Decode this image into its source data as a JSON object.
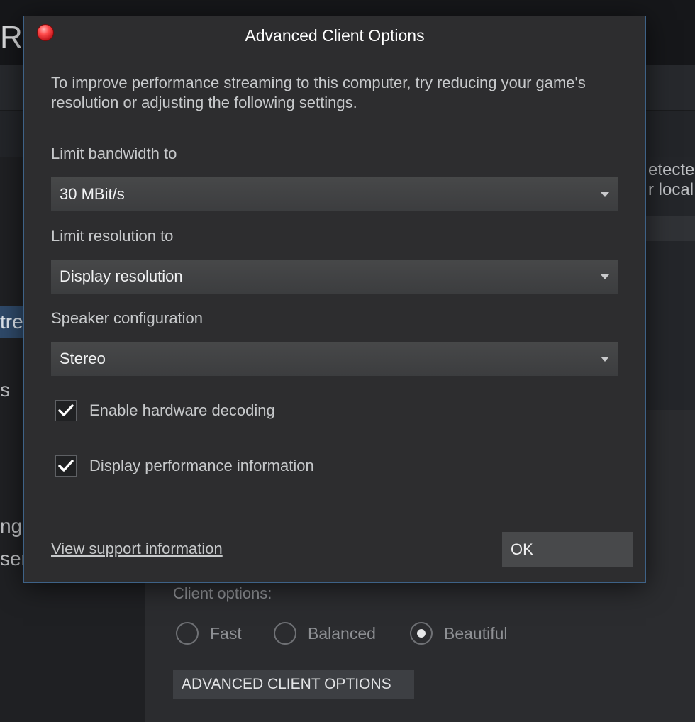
{
  "background": {
    "logo_fragment": "RI",
    "right_fragment_1": "etecte",
    "right_fragment_2": "r local",
    "sidebar_active_fragment": "tre",
    "sidebar_fragment_1": "s",
    "sidebar_fragment_2": "ng",
    "sidebar_fragment_3": "ser",
    "client_options_label": "Client options:",
    "radios": [
      {
        "label": "Fast",
        "selected": false
      },
      {
        "label": "Balanced",
        "selected": false
      },
      {
        "label": "Beautiful",
        "selected": true
      }
    ],
    "advanced_button_label": "ADVANCED CLIENT OPTIONS"
  },
  "dialog": {
    "title": "Advanced Client Options",
    "intro": "To improve performance streaming to this computer, try reducing your game's resolution or adjusting the following settings.",
    "bandwidth": {
      "label": "Limit bandwidth to",
      "value": "30 MBit/s"
    },
    "resolution": {
      "label": "Limit resolution to",
      "value": "Display resolution"
    },
    "speaker": {
      "label": "Speaker configuration",
      "value": "Stereo"
    },
    "checkboxes": [
      {
        "label": "Enable hardware decoding",
        "checked": true
      },
      {
        "label": "Display performance information",
        "checked": true
      }
    ],
    "support_link": "View support information",
    "ok_label": "OK"
  },
  "colors": {
    "dialog_border": "#3e6287",
    "close_button": "#ff4b4b",
    "sidebar_active": "#2f4a6a"
  }
}
